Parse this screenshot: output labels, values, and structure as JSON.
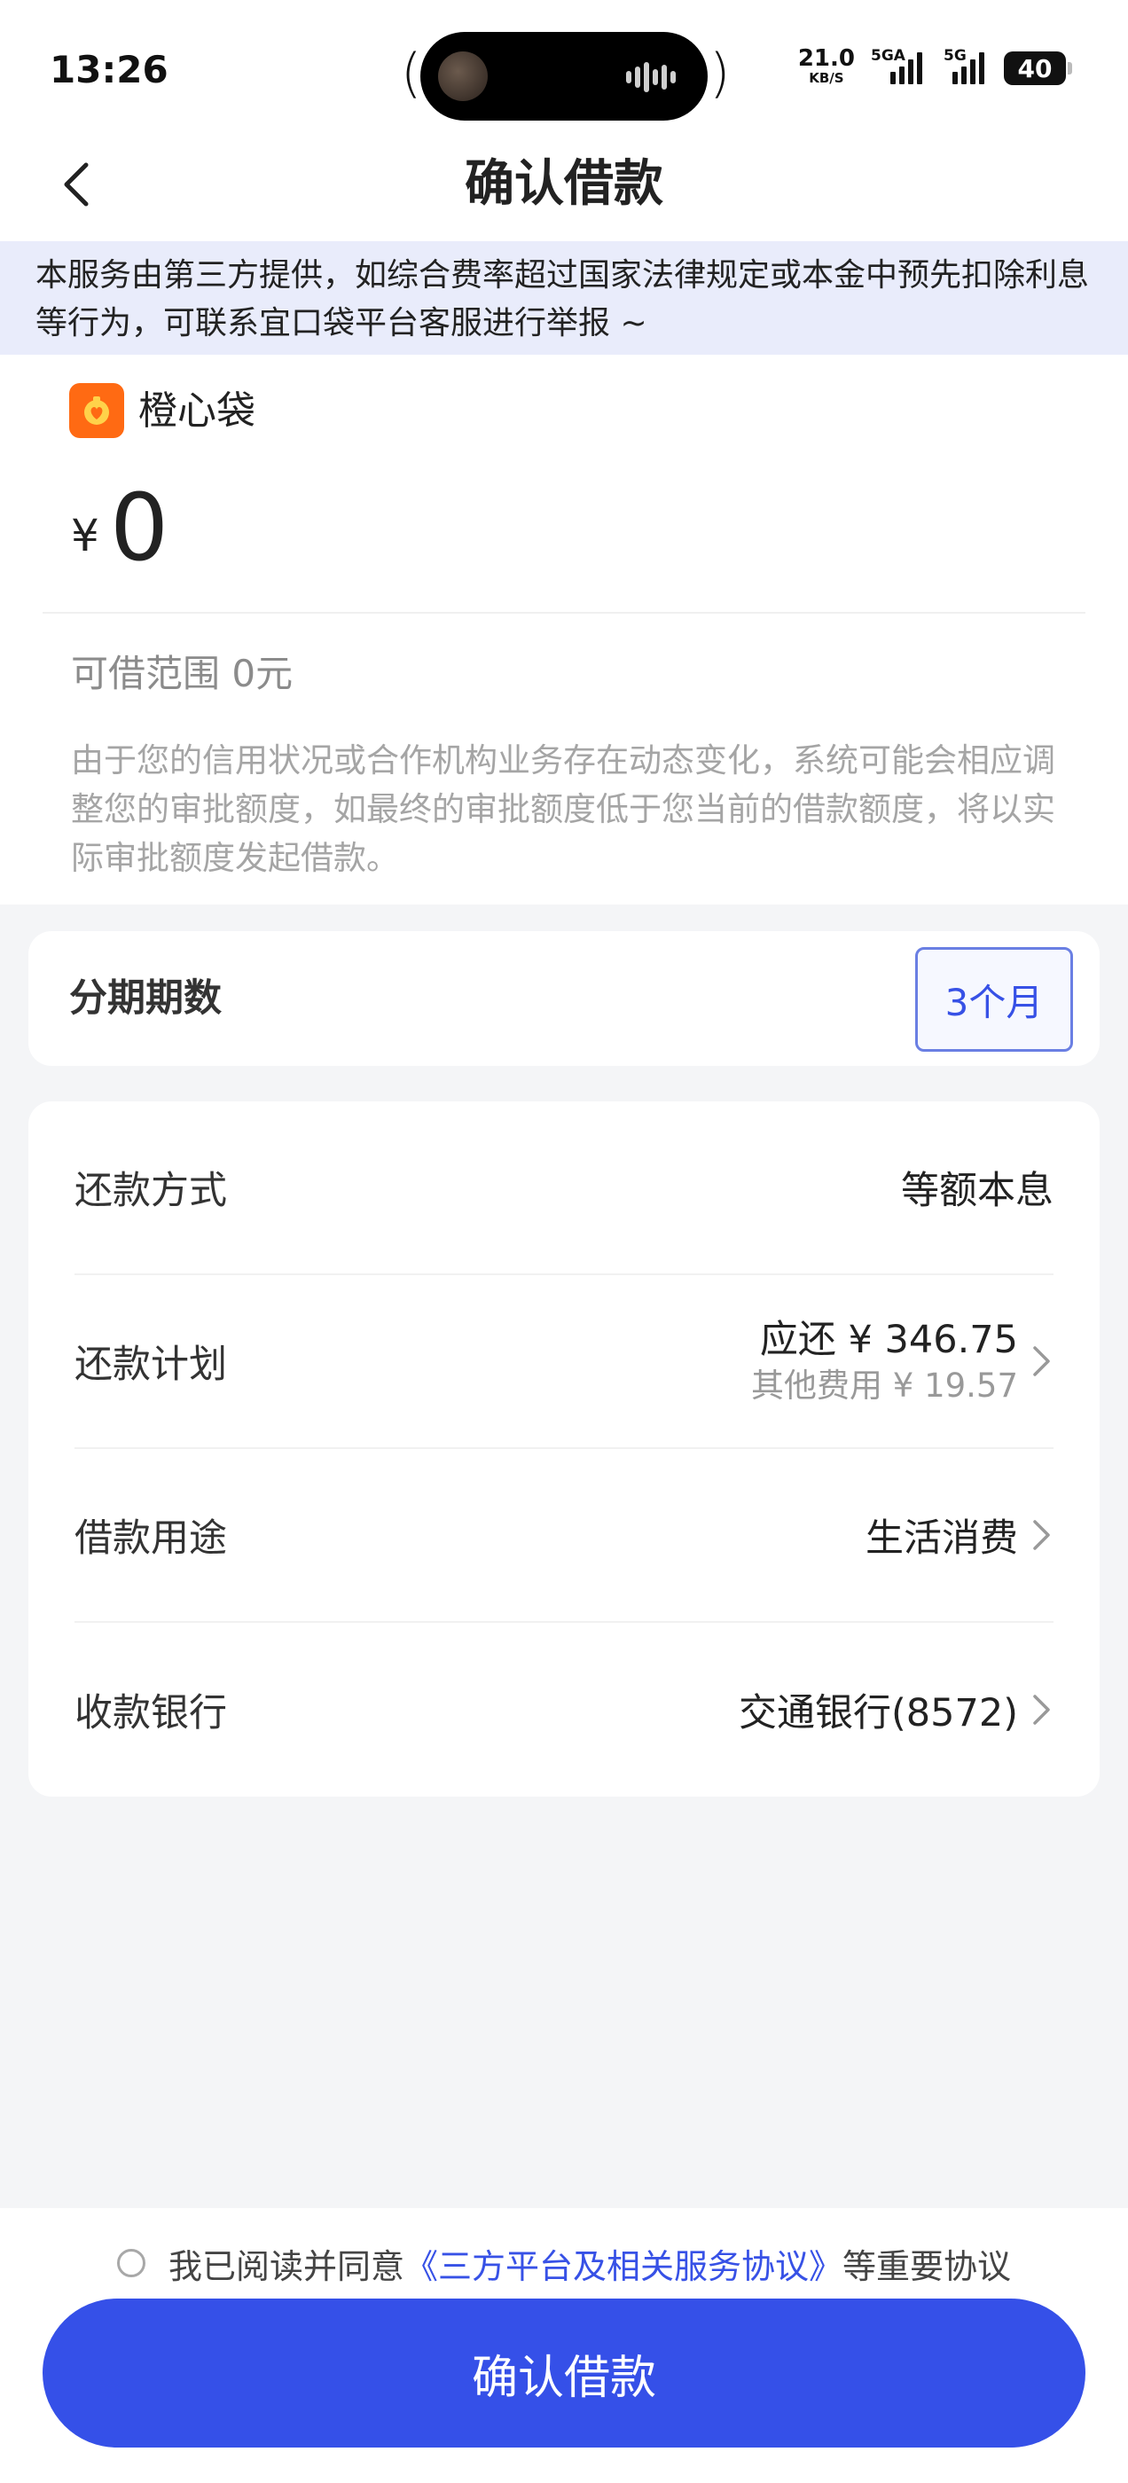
{
  "status_bar": {
    "time": "13:26",
    "net_speed": "21.0",
    "net_unit": "KB/S",
    "signal1_tag": "5GA",
    "signal2_tag": "5G",
    "battery": "40"
  },
  "header": {
    "title": "确认借款"
  },
  "notice": {
    "text": "本服务由第三方提供，如综合费率超过国家法律规定或本金中预先扣除利息等行为，可联系宜口袋平台客服进行举报 ~"
  },
  "loan": {
    "lender_name": "橙心袋",
    "currency_symbol": "¥",
    "amount": "0",
    "range_text": "可借范围 0元",
    "disclaimer": "由于您的信用状况或合作机构业务存在动态变化，系统可能会相应调整您的审批额度，如最终的审批额度低于您当前的借款额度，将以实际审批额度发起借款。"
  },
  "installment": {
    "label": "分期期数",
    "selected": "3个月"
  },
  "details": {
    "repay_method_label": "还款方式",
    "repay_method_value": "等额本息",
    "plan_label": "还款计划",
    "plan_due": "应还 ¥ 346.75",
    "plan_fee": "其他费用 ¥ 19.57",
    "purpose_label": "借款用途",
    "purpose_value": "生活消费",
    "bank_label": "收款银行",
    "bank_value": "交通银行(8572)"
  },
  "agreement": {
    "prefix": "我已阅读并同意",
    "link": "《三方平台及相关服务协议》",
    "suffix": "等重要协议"
  },
  "confirm_button": {
    "label": "确认借款"
  },
  "colors": {
    "accent": "#3550e8",
    "notice_bg": "#e9ecfb",
    "lender_logo": "#ff6a13"
  }
}
